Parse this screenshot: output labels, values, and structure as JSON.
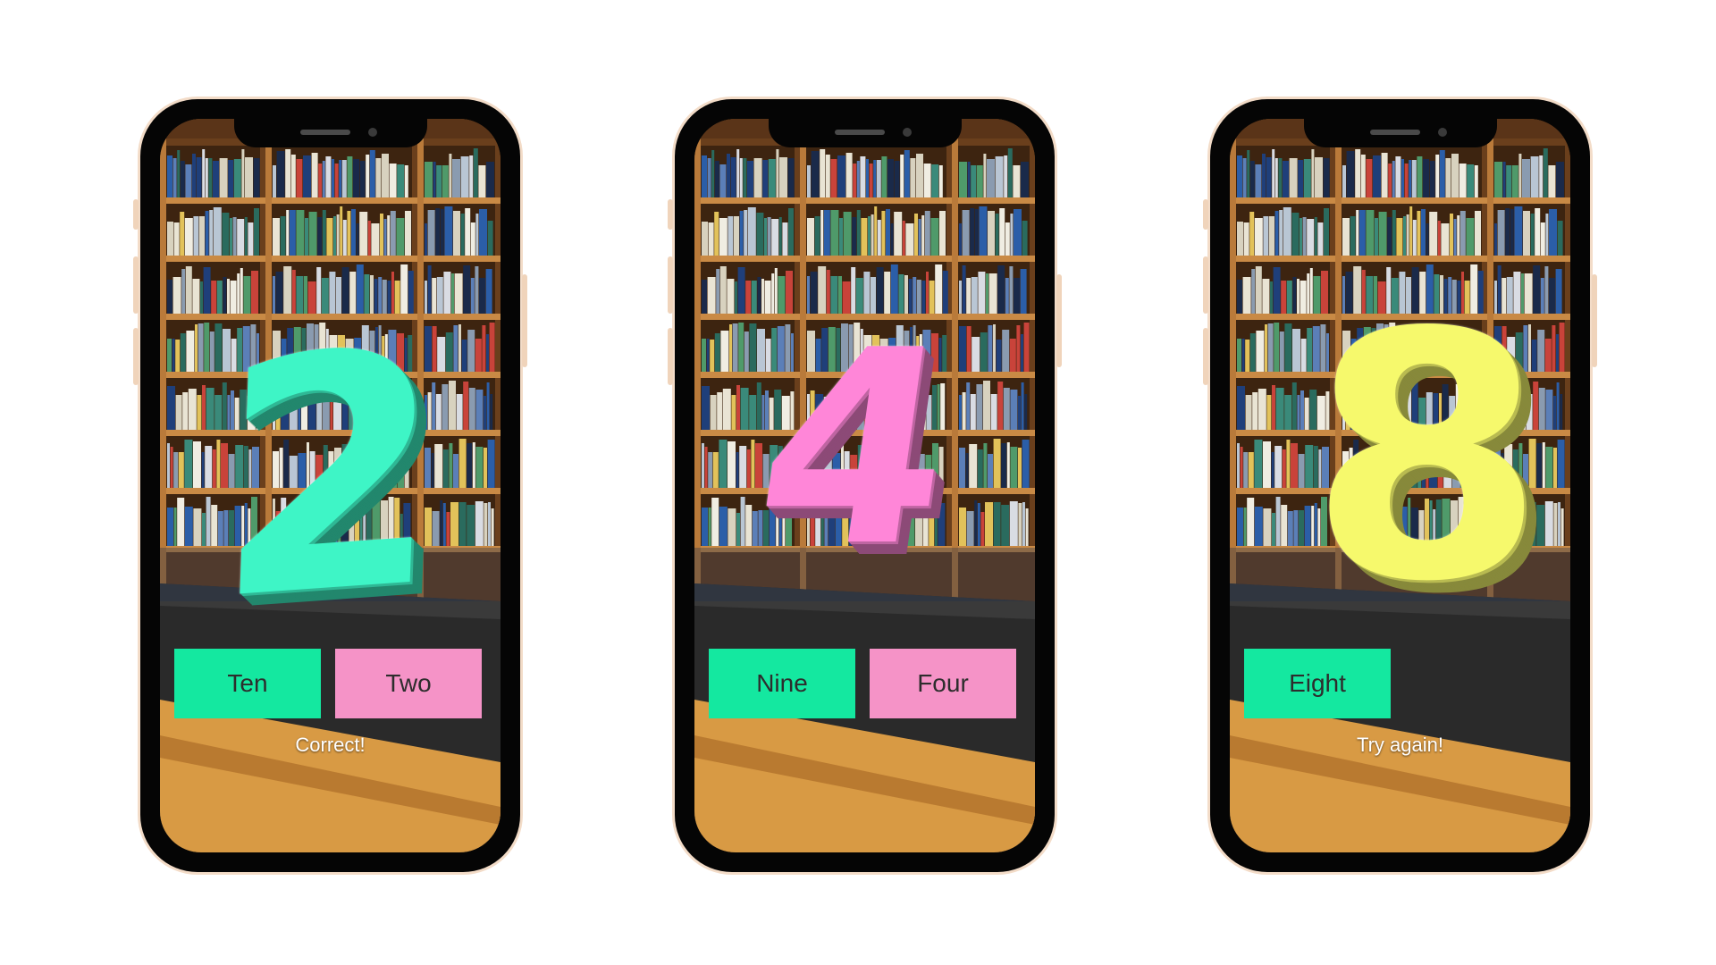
{
  "colors": {
    "button_green": "#14e8a0",
    "button_pink": "#f593c7",
    "phone_frame": "#050505",
    "phone_rim": "#f3dcc8",
    "digit_teal": "#3ef5c6",
    "digit_pink": "#ff86d8",
    "digit_yellow": "#f6f96c"
  },
  "phones": [
    {
      "digit": "2",
      "digit_color": "#3ef5c6",
      "options": [
        {
          "label": "Ten",
          "color": "#14e8a0"
        },
        {
          "label": "Two",
          "color": "#f593c7"
        }
      ],
      "feedback": "Correct!"
    },
    {
      "digit": "4",
      "digit_color": "#ff86d8",
      "options": [
        {
          "label": "Nine",
          "color": "#14e8a0"
        },
        {
          "label": "Four",
          "color": "#f593c7"
        }
      ],
      "feedback": ""
    },
    {
      "digit": "8",
      "digit_color": "#f6f96c",
      "options": [
        {
          "label": "Eight",
          "color": "#14e8a0"
        }
      ],
      "feedback": "Try again!"
    }
  ]
}
